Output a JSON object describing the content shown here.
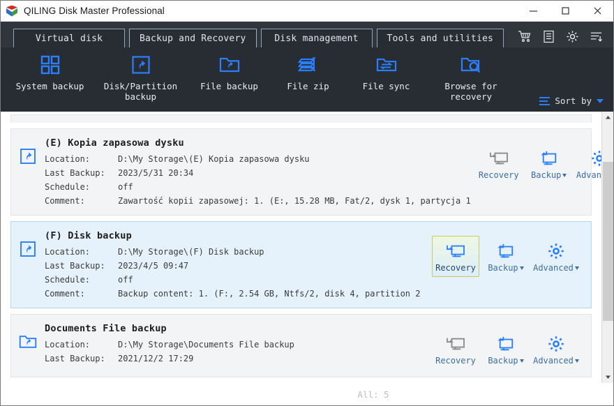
{
  "window": {
    "title": "QILING Disk Master Professional",
    "icon": "app-cube-icon",
    "controls": {
      "minimize": "minimize-icon",
      "maximize": "maximize-icon",
      "close": "close-icon"
    }
  },
  "tabs": [
    {
      "label": "Virtual disk",
      "active": false
    },
    {
      "label": "Backup and Recovery",
      "active": true
    },
    {
      "label": "Disk management",
      "active": false
    },
    {
      "label": "Tools and utilities",
      "active": false
    }
  ],
  "tab_icons": [
    {
      "name": "cart-icon"
    },
    {
      "name": "list-document-icon"
    },
    {
      "name": "gear-icon"
    },
    {
      "name": "menu-sort-icon"
    }
  ],
  "toolbar": {
    "items": [
      {
        "label": "System backup",
        "icon": "grid-squares-icon"
      },
      {
        "label": "Disk/Partition\nbackup",
        "icon": "disk-partition-icon"
      },
      {
        "label": "File backup",
        "icon": "folder-backup-icon"
      },
      {
        "label": "File zip",
        "icon": "file-zip-icon"
      },
      {
        "label": "File sync",
        "icon": "folder-sync-icon"
      },
      {
        "label": "Browse for\nrecovery",
        "icon": "folder-search-icon"
      }
    ],
    "sort_by": {
      "label": "Sort by",
      "icon": "sort-lines-icon",
      "caret": "chevron-down-icon"
    }
  },
  "backups": [
    {
      "title": "(E) Kopia zapasowa dysku",
      "icon": "disk-partition-icon",
      "selected": false,
      "fields": [
        {
          "key": "Location:",
          "value": "D:\\My Storage\\(E) Kopia zapasowa dysku"
        },
        {
          "key": "Last Backup:",
          "value": "2023/5/31 20:34"
        },
        {
          "key": "Schedule:",
          "value": "off"
        },
        {
          "key": "Comment:",
          "value": "Zawartość kopii zapasowej:  1. (E:, 15.28 MB, Fat/2, dysk 1, partycja 1"
        }
      ],
      "actions": [
        {
          "label": "Recovery",
          "icon": "recovery-monitor-icon",
          "caret": false,
          "highlighted": false,
          "disabled_icon": true
        },
        {
          "label": "Backup",
          "icon": "backup-monitor-icon",
          "caret": true,
          "highlighted": false,
          "disabled_icon": false
        },
        {
          "label": "Advanced",
          "icon": "gear-icon",
          "caret": true,
          "highlighted": false,
          "disabled_icon": false
        }
      ]
    },
    {
      "title": "(F) Disk backup",
      "icon": "disk-partition-icon",
      "selected": true,
      "fields": [
        {
          "key": "Location:",
          "value": "D:\\My Storage\\(F) Disk backup"
        },
        {
          "key": "Last Backup:",
          "value": "2023/4/5 09:47"
        },
        {
          "key": "Schedule:",
          "value": "off"
        },
        {
          "key": "Comment:",
          "value": "Backup content:  1. (F:, 2.54 GB, Ntfs/2, disk 4, partition 2"
        }
      ],
      "actions": [
        {
          "label": "Recovery",
          "icon": "recovery-monitor-icon",
          "caret": false,
          "highlighted": true,
          "disabled_icon": false
        },
        {
          "label": "Backup",
          "icon": "backup-monitor-icon",
          "caret": true,
          "highlighted": false,
          "disabled_icon": false
        },
        {
          "label": "Advanced",
          "icon": "gear-icon",
          "caret": true,
          "highlighted": false,
          "disabled_icon": false
        }
      ]
    },
    {
      "title": "Documents File backup",
      "icon": "folder-backup-icon",
      "selected": false,
      "fields": [
        {
          "key": "Location:",
          "value": "D:\\My Storage\\Documents File backup"
        },
        {
          "key": "Last Backup:",
          "value": "2021/12/2 17:29"
        }
      ],
      "actions": [
        {
          "label": "Recovery",
          "icon": "recovery-monitor-icon",
          "caret": false,
          "highlighted": false,
          "disabled_icon": true
        },
        {
          "label": "Backup",
          "icon": "backup-monitor-icon",
          "caret": true,
          "highlighted": false,
          "disabled_icon": false
        },
        {
          "label": "Advanced",
          "icon": "gear-icon",
          "caret": true,
          "highlighted": false,
          "disabled_icon": false
        }
      ]
    }
  ],
  "statusbar": {
    "all_count": "All: 5"
  },
  "colors": {
    "accent_blue": "#2a7fff",
    "dark_chrome": "#282c33",
    "tab_bar": "#31353c",
    "selected_card": "#e6f2fb",
    "highlight_border": "#c8cc60"
  }
}
